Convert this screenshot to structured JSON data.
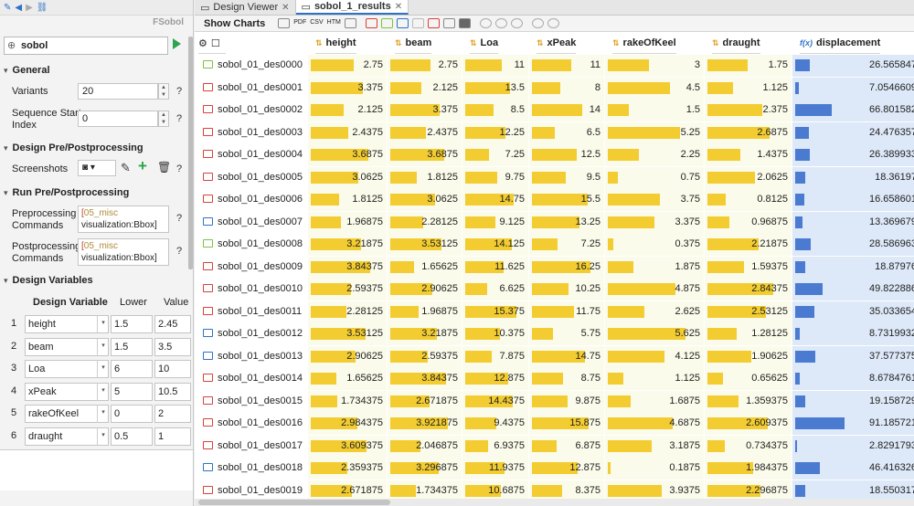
{
  "left_panel": {
    "brand": "FSobol",
    "name_value": "sobol",
    "general_label": "General",
    "variants_label": "Variants",
    "variants_value": "20",
    "seq_label_1": "Sequence Start",
    "seq_label_2": "Index",
    "seq_value": "0",
    "design_pp_label": "Design Pre/Postprocessing",
    "screenshots_label": "Screenshots",
    "run_pp_label": "Run Pre/Postprocessing",
    "pre_label_1": "Preprocessing",
    "pre_label_2": "Commands",
    "post_label_1": "Postprocessing",
    "post_label_2": "Commands",
    "cmd_bracket": "[",
    "cmd_misc": "05_misc",
    "cmd_line2": "visualization:Bbox]",
    "design_vars_label": "Design Variables",
    "col_var": "Design Variable",
    "col_lower": "Lower",
    "col_value": "Value",
    "help": "?",
    "variables": [
      {
        "n": "1",
        "name": "height",
        "lower": "1.5",
        "value": "2.45"
      },
      {
        "n": "2",
        "name": "beam",
        "lower": "1.5",
        "value": "3.5"
      },
      {
        "n": "3",
        "name": "Loa",
        "lower": "6",
        "value": "10"
      },
      {
        "n": "4",
        "name": "xPeak",
        "lower": "5",
        "value": "10.5"
      },
      {
        "n": "5",
        "name": "rakeOfKeel",
        "lower": "0",
        "value": "2"
      },
      {
        "n": "6",
        "name": "draught",
        "lower": "0.5",
        "value": "1"
      }
    ]
  },
  "tabs": {
    "design_viewer": "Design Viewer",
    "results": "sobol_1_results"
  },
  "toolbar": {
    "show_charts": "Show Charts",
    "pdf": "PDF",
    "csv": "CSV",
    "htm": "HTM"
  },
  "table": {
    "columns": [
      "height",
      "beam",
      "Loa",
      "xPeak",
      "rakeOfKeel",
      "draught",
      "displacement"
    ],
    "max": [
      4.0,
      4.0,
      15.5,
      16.5,
      5.75,
      3.0,
      95.0
    ],
    "rows": [
      {
        "name": "sobol_01_des0000",
        "status": "green",
        "v": [
          "2.75",
          "2.75",
          "11",
          "11",
          "3",
          "1.75",
          "26.565847"
        ]
      },
      {
        "name": "sobol_01_des0001",
        "status": "red",
        "v": [
          "3.375",
          "2.125",
          "13.5",
          "8",
          "4.5",
          "1.125",
          "7.0546609"
        ]
      },
      {
        "name": "sobol_01_des0002",
        "status": "red",
        "v": [
          "2.125",
          "3.375",
          "8.5",
          "14",
          "1.5",
          "2.375",
          "66.801582"
        ]
      },
      {
        "name": "sobol_01_des0003",
        "status": "red",
        "v": [
          "2.4375",
          "2.4375",
          "12.25",
          "6.5",
          "5.25",
          "2.6875",
          "24.476357"
        ]
      },
      {
        "name": "sobol_01_des0004",
        "status": "red",
        "v": [
          "3.6875",
          "3.6875",
          "7.25",
          "12.5",
          "2.25",
          "1.4375",
          "26.389933"
        ]
      },
      {
        "name": "sobol_01_des0005",
        "status": "red",
        "v": [
          "3.0625",
          "1.8125",
          "9.75",
          "9.5",
          "0.75",
          "2.0625",
          "18.36197"
        ]
      },
      {
        "name": "sobol_01_des0006",
        "status": "red",
        "v": [
          "1.8125",
          "3.0625",
          "14.75",
          "15.5",
          "3.75",
          "0.8125",
          "16.658601"
        ]
      },
      {
        "name": "sobol_01_des0007",
        "status": "blue",
        "v": [
          "1.96875",
          "2.28125",
          "9.125",
          "13.25",
          "3.375",
          "0.96875",
          "13.369679"
        ]
      },
      {
        "name": "sobol_01_des0008",
        "status": "green",
        "v": [
          "3.21875",
          "3.53125",
          "14.125",
          "7.25",
          "0.375",
          "2.21875",
          "28.586963"
        ]
      },
      {
        "name": "sobol_01_des0009",
        "status": "red",
        "v": [
          "3.84375",
          "1.65625",
          "11.625",
          "16.25",
          "1.875",
          "1.59375",
          "18.87976"
        ]
      },
      {
        "name": "sobol_01_des0010",
        "status": "red",
        "v": [
          "2.59375",
          "2.90625",
          "6.625",
          "10.25",
          "4.875",
          "2.84375",
          "49.822886"
        ]
      },
      {
        "name": "sobol_01_des0011",
        "status": "red",
        "v": [
          "2.28125",
          "1.96875",
          "15.375",
          "11.75",
          "2.625",
          "2.53125",
          "35.033654"
        ]
      },
      {
        "name": "sobol_01_des0012",
        "status": "blue",
        "v": [
          "3.53125",
          "3.21875",
          "10.375",
          "5.75",
          "5.625",
          "1.28125",
          "8.7319932"
        ]
      },
      {
        "name": "sobol_01_des0013",
        "status": "blue",
        "v": [
          "2.90625",
          "2.59375",
          "7.875",
          "14.75",
          "4.125",
          "1.90625",
          "37.577375"
        ]
      },
      {
        "name": "sobol_01_des0014",
        "status": "red",
        "v": [
          "1.65625",
          "3.84375",
          "12.875",
          "8.75",
          "1.125",
          "0.65625",
          "8.6784761"
        ]
      },
      {
        "name": "sobol_01_des0015",
        "status": "red",
        "v": [
          "1.734375",
          "2.671875",
          "14.4375",
          "9.875",
          "1.6875",
          "1.359375",
          "19.158729"
        ]
      },
      {
        "name": "sobol_01_des0016",
        "status": "red",
        "v": [
          "2.984375",
          "3.921875",
          "9.4375",
          "15.875",
          "4.6875",
          "2.609375",
          "91.185721"
        ]
      },
      {
        "name": "sobol_01_des0017",
        "status": "red",
        "v": [
          "3.609375",
          "2.046875",
          "6.9375",
          "6.875",
          "3.1875",
          "0.734375",
          "2.8291793"
        ]
      },
      {
        "name": "sobol_01_des0018",
        "status": "blue",
        "v": [
          "2.359375",
          "3.296875",
          "11.9375",
          "12.875",
          "0.1875",
          "1.984375",
          "46.416326"
        ]
      },
      {
        "name": "sobol_01_des0019",
        "status": "red",
        "v": [
          "2.671875",
          "1.734375",
          "10.6875",
          "8.375",
          "3.9375",
          "2.296875",
          "18.550317"
        ]
      }
    ],
    "colors": {
      "red": "#d9403a",
      "green": "#7cc43a",
      "blue": "#2e72c8",
      "bar": "#f2cc30",
      "disp_bar": "#4a7bd0"
    }
  }
}
